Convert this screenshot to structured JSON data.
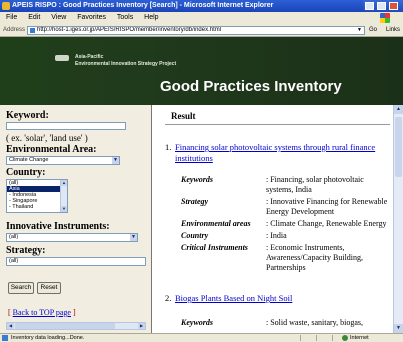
{
  "window": {
    "title": "APEIS RISPO : Good Practices Inventory [Search] - Microsoft Internet Explorer"
  },
  "menu": [
    "File",
    "Edit",
    "View",
    "Favorites",
    "Tools",
    "Help"
  ],
  "address": {
    "label": "Address",
    "url": "http://host-1.iges.or.jp/APEIS/RISPO/member/inventory/db/index.html",
    "go_label": "Go",
    "links_label": "Links"
  },
  "banner": {
    "org_line1": "Asia-Pacific",
    "org_line2": "Environmental Innovation Strategy Project",
    "site_title": "Good Practices Inventory"
  },
  "search": {
    "keyword_label": "Keyword:",
    "keyword_value": "",
    "keyword_hint": "( ex. 'solar', 'land use' )",
    "env_area_label": "Environmental Area:",
    "env_area_value": "Climate Change",
    "country_label": "Country:",
    "country_options": [
      "(all)",
      "Asia",
      "- Indonesia",
      "- Singapore",
      "- Thailand"
    ],
    "country_selected_index": 1,
    "instruments_label": "Innovative Instruments:",
    "instruments_value": "(all)",
    "strategy_label": "Strategy:",
    "strategy_value": "(all)",
    "search_button": "Search",
    "reset_button": "Reset",
    "top_link_prefix": "[",
    "top_link_text": "Back to TOP page",
    "top_link_suffix": "]"
  },
  "results": {
    "heading": "Result",
    "items": [
      {
        "number": "1.",
        "title": "Financing solar photovoltaic systems through rural finance institutions",
        "fields": [
          {
            "label": "Keywords",
            "value": ": Financing, solar photovoltaic systems, India"
          },
          {
            "label": "Strategy",
            "value": ": Innovative Financing for Renewable Energy Development"
          },
          {
            "label": "Environmental areas",
            "value": ": Climate Change, Renewable Energy"
          },
          {
            "label": "Country",
            "value": ": India"
          },
          {
            "label": "Critical Instruments",
            "value": ": Economic Instruments, Awareness/Capacity Building, Partnerships"
          }
        ]
      },
      {
        "number": "2.",
        "title": "Biogas Plants Based on Night Soil",
        "fields": [
          {
            "label": "Keywords",
            "value": ": Solid waste, sanitary, biogas,"
          }
        ]
      }
    ]
  },
  "status": {
    "text": "Inventory data loading...Done.",
    "zone": "Internet"
  },
  "colors": {
    "banner_bg": "#1f3f1a",
    "link": "#0000cc",
    "left_panel_bg": "#f1ede1"
  }
}
